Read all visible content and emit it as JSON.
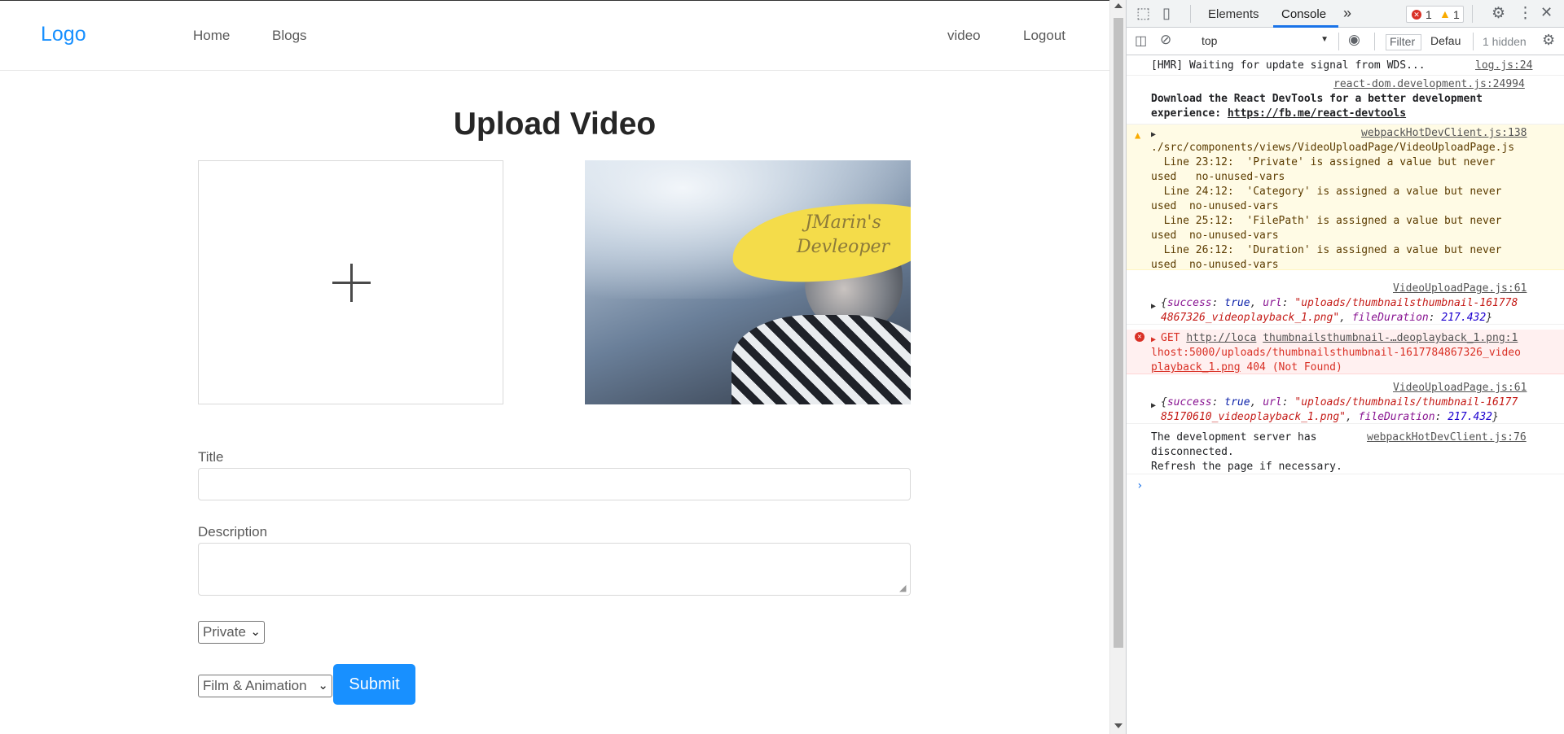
{
  "navbar": {
    "logo": "Logo",
    "left_links": [
      "Home",
      "Blogs"
    ],
    "right_links": [
      "video",
      "Logout"
    ]
  },
  "upload": {
    "title": "Upload Video",
    "thumbnail_text": "JMarin's\nDevleoper"
  },
  "form": {
    "title_label": "Title",
    "title_value": "",
    "description_label": "Description",
    "description_value": "",
    "privacy_selected": "Private",
    "category_selected": "Film & Animation",
    "submit_label": "Submit"
  },
  "devtools": {
    "tabs": [
      "Elements",
      "Console"
    ],
    "active_tab": "Console",
    "more_tabs": "»",
    "error_count": "1",
    "warning_count": "1",
    "context": "top",
    "filter_placeholder": "Filter",
    "levels": "Defau",
    "hidden": "1 hidden",
    "messages": {
      "m1_text": "[HMR] Waiting for update signal from WDS...",
      "m1_src": "log.js:24",
      "m2_src": "react-dom.development.js:24994",
      "m2_text_a": "Download the React DevTools for a better development",
      "m2_text_b": "experience: ",
      "m2_link": "https://fb.me/react-devtools",
      "m3_src": "webpackHotDevClient.js:138",
      "m3_path": "./src/components/views/VideoUploadPage/VideoUploadPage.js",
      "m3_l1": "  Line 23:12:  'Private' is assigned a value but never",
      "m3_l2": "used   no-unused-vars",
      "m3_l3": "  Line 24:12:  'Category' is assigned a value but never",
      "m3_l4": "used  no-unused-vars",
      "m3_l5": "  Line 25:12:  'FilePath' is assigned a value but never",
      "m3_l6": "used  no-unused-vars",
      "m3_l7": "  Line 26:12:  'Duration' is assigned a value but never",
      "m3_l8": "used  no-unused-vars",
      "m4_src": "VideoUploadPage.js:61",
      "m4_a_key1": "success",
      "m4_a_val1": "true",
      "m4_a_key2": "url",
      "m4_a_val2": "\"uploads/thumbnailsthumbnail-161778",
      "m4_b_val2": "4867326_videoplayback_1.png\"",
      "m4_b_key3": "fileDuration",
      "m4_b_val3": "217.432",
      "m5_get": "GET ",
      "m5_link_a": "http://loca",
      "m5_link_b": "thumbnailsthumbnail-…deoplayback_1.png:1",
      "m5_line2": "lhost:5000/uploads/thumbnailsthumbnail-1617784867326_video",
      "m5_line3_link": "playback_1.png",
      "m5_status": " 404 (Not Found)",
      "m6_src": "VideoUploadPage.js:61",
      "m6_a_val2": "\"uploads/thumbnails/thumbnail-16177",
      "m6_b_val2": "85170610_videoplayback_1.png\"",
      "m6_b_val3": "217.432",
      "m7_text_a": "The development server has",
      "m7_src": "webpackHotDevClient.js:76",
      "m7_text_b": "disconnected.",
      "m7_text_c": "Refresh the page if necessary."
    }
  },
  "colors": {
    "primary": "#1890ff",
    "devtools_active": "#1a73e8",
    "warning_bg": "#fffbe5",
    "error_bg": "#fff0f0"
  }
}
